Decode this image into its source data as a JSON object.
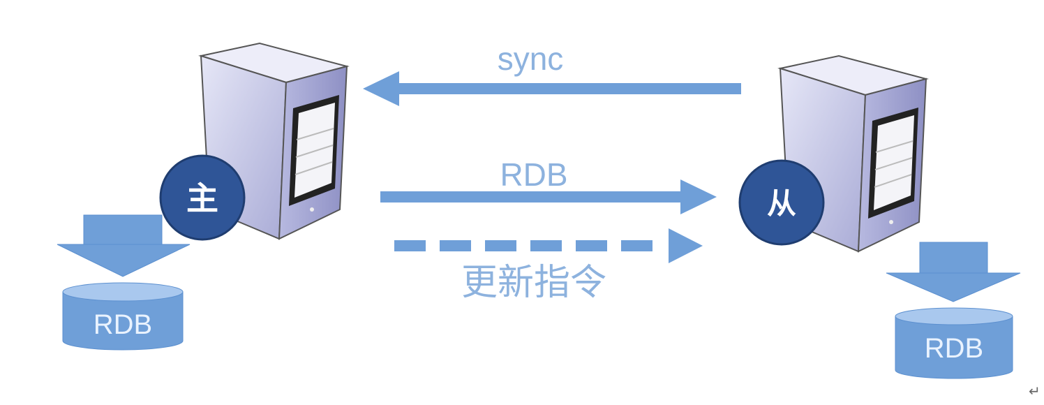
{
  "labels": {
    "sync": "sync",
    "rdb_transfer": "RDB",
    "update_commands": "更新指令"
  },
  "master": {
    "badge": "主",
    "db_label": "RDB"
  },
  "slave": {
    "badge": "从",
    "db_label": "RDB"
  },
  "paragraph_mark": "↵",
  "colors": {
    "arrow": "#6f9fd8",
    "badge": "#2f5597",
    "server": "#c8c9ea",
    "label": "#8db2de"
  }
}
